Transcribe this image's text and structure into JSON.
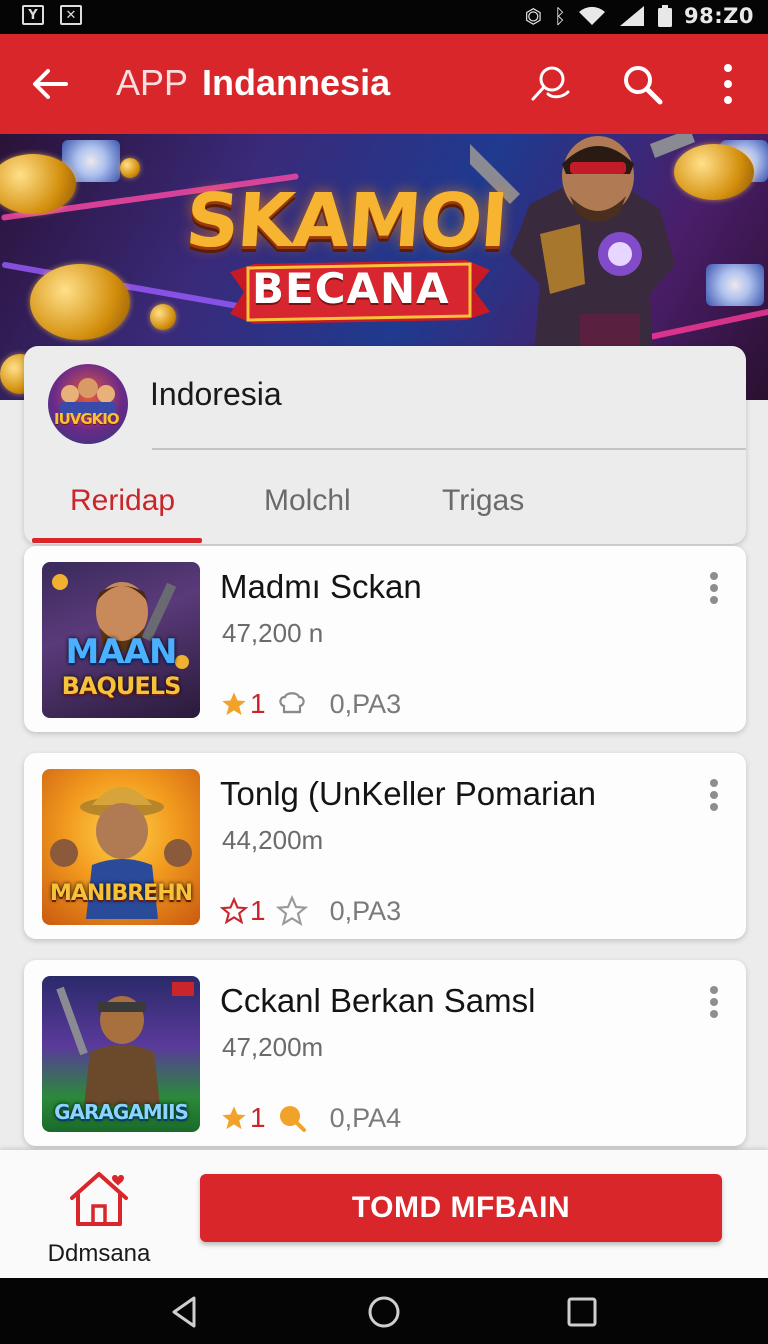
{
  "status_bar": {
    "time": "98:Z0"
  },
  "app_bar": {
    "prefix": "APP",
    "title": "Indannesia"
  },
  "hero": {
    "headline": "SKAMOI",
    "ribbon": "BECANA"
  },
  "profile": {
    "avatar_text": "IUVGKIO",
    "name": "Indoresia",
    "tabs": [
      "Reridap",
      "Molchl",
      "Trigas"
    ],
    "active_tab": 0
  },
  "items": [
    {
      "title": "Madmı Sckan",
      "count": "47,200 n",
      "rating": "1",
      "meta": "0,PA3",
      "thumb_text": "MAAN BAQUELS",
      "thumb_line1": "MAAN",
      "thumb_line2": "BAQUELS",
      "rating_style": "filled",
      "meta_icon": "chef-hat-icon"
    },
    {
      "title": "Tonlg (UnKeller Pomarian",
      "count": "44,200m",
      "rating": "1",
      "meta": "0,PA3",
      "thumb_text": "MANIBREHN",
      "thumb_line1": "MANIBREHN",
      "rating_style": "outline",
      "meta_icon": "star-outline-icon"
    },
    {
      "title": "Cckanl Berkan Samsl",
      "count": "47,200m",
      "rating": "1",
      "meta": "0,PA4",
      "thumb_text": "GARAGAMIIS",
      "thumb_line1": "GARAGAMIIS",
      "rating_style": "filled",
      "meta_icon": "search-bubble-icon"
    }
  ],
  "bottom_bar": {
    "home_label": "Ddmsana",
    "cta_label": "TOMD MFBAIN"
  },
  "colors": {
    "primary": "#d8262a",
    "star": "#f0a229",
    "muted": "#7a7a7a"
  }
}
